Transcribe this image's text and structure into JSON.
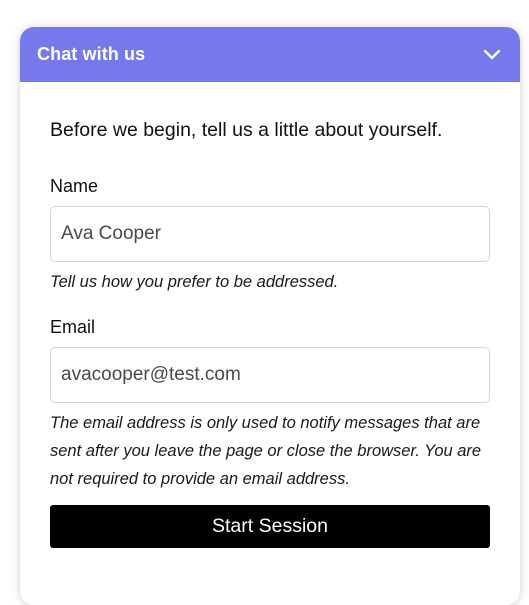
{
  "header": {
    "title": "Chat with us",
    "toggle_icon": "chevron-down-icon",
    "background_color": "#7579ec"
  },
  "form": {
    "intro": "Before we begin, tell us a little about yourself.",
    "name": {
      "label": "Name",
      "value": "Ava Cooper",
      "hint": "Tell us how you prefer to be addressed."
    },
    "email": {
      "label": "Email",
      "value": "avacooper@test.com",
      "hint": "The email address is only used to notify messages that are sent after you leave the page or close the browser. You are not required to provide an email address."
    },
    "submit_label": "Start Session"
  }
}
